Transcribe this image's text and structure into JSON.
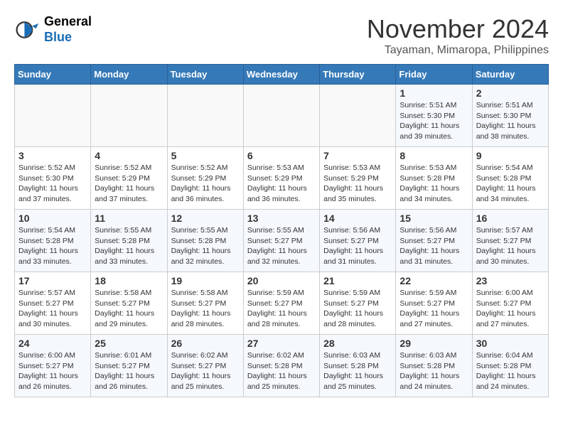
{
  "header": {
    "logo_line1": "General",
    "logo_line2": "Blue",
    "month": "November 2024",
    "location": "Tayaman, Mimaropa, Philippines"
  },
  "days_of_week": [
    "Sunday",
    "Monday",
    "Tuesday",
    "Wednesday",
    "Thursday",
    "Friday",
    "Saturday"
  ],
  "weeks": [
    [
      {
        "day": "",
        "info": ""
      },
      {
        "day": "",
        "info": ""
      },
      {
        "day": "",
        "info": ""
      },
      {
        "day": "",
        "info": ""
      },
      {
        "day": "",
        "info": ""
      },
      {
        "day": "1",
        "info": "Sunrise: 5:51 AM\nSunset: 5:30 PM\nDaylight: 11 hours\nand 39 minutes."
      },
      {
        "day": "2",
        "info": "Sunrise: 5:51 AM\nSunset: 5:30 PM\nDaylight: 11 hours\nand 38 minutes."
      }
    ],
    [
      {
        "day": "3",
        "info": "Sunrise: 5:52 AM\nSunset: 5:30 PM\nDaylight: 11 hours\nand 37 minutes."
      },
      {
        "day": "4",
        "info": "Sunrise: 5:52 AM\nSunset: 5:29 PM\nDaylight: 11 hours\nand 37 minutes."
      },
      {
        "day": "5",
        "info": "Sunrise: 5:52 AM\nSunset: 5:29 PM\nDaylight: 11 hours\nand 36 minutes."
      },
      {
        "day": "6",
        "info": "Sunrise: 5:53 AM\nSunset: 5:29 PM\nDaylight: 11 hours\nand 36 minutes."
      },
      {
        "day": "7",
        "info": "Sunrise: 5:53 AM\nSunset: 5:29 PM\nDaylight: 11 hours\nand 35 minutes."
      },
      {
        "day": "8",
        "info": "Sunrise: 5:53 AM\nSunset: 5:28 PM\nDaylight: 11 hours\nand 34 minutes."
      },
      {
        "day": "9",
        "info": "Sunrise: 5:54 AM\nSunset: 5:28 PM\nDaylight: 11 hours\nand 34 minutes."
      }
    ],
    [
      {
        "day": "10",
        "info": "Sunrise: 5:54 AM\nSunset: 5:28 PM\nDaylight: 11 hours\nand 33 minutes."
      },
      {
        "day": "11",
        "info": "Sunrise: 5:55 AM\nSunset: 5:28 PM\nDaylight: 11 hours\nand 33 minutes."
      },
      {
        "day": "12",
        "info": "Sunrise: 5:55 AM\nSunset: 5:28 PM\nDaylight: 11 hours\nand 32 minutes."
      },
      {
        "day": "13",
        "info": "Sunrise: 5:55 AM\nSunset: 5:27 PM\nDaylight: 11 hours\nand 32 minutes."
      },
      {
        "day": "14",
        "info": "Sunrise: 5:56 AM\nSunset: 5:27 PM\nDaylight: 11 hours\nand 31 minutes."
      },
      {
        "day": "15",
        "info": "Sunrise: 5:56 AM\nSunset: 5:27 PM\nDaylight: 11 hours\nand 31 minutes."
      },
      {
        "day": "16",
        "info": "Sunrise: 5:57 AM\nSunset: 5:27 PM\nDaylight: 11 hours\nand 30 minutes."
      }
    ],
    [
      {
        "day": "17",
        "info": "Sunrise: 5:57 AM\nSunset: 5:27 PM\nDaylight: 11 hours\nand 30 minutes."
      },
      {
        "day": "18",
        "info": "Sunrise: 5:58 AM\nSunset: 5:27 PM\nDaylight: 11 hours\nand 29 minutes."
      },
      {
        "day": "19",
        "info": "Sunrise: 5:58 AM\nSunset: 5:27 PM\nDaylight: 11 hours\nand 28 minutes."
      },
      {
        "day": "20",
        "info": "Sunrise: 5:59 AM\nSunset: 5:27 PM\nDaylight: 11 hours\nand 28 minutes."
      },
      {
        "day": "21",
        "info": "Sunrise: 5:59 AM\nSunset: 5:27 PM\nDaylight: 11 hours\nand 28 minutes."
      },
      {
        "day": "22",
        "info": "Sunrise: 5:59 AM\nSunset: 5:27 PM\nDaylight: 11 hours\nand 27 minutes."
      },
      {
        "day": "23",
        "info": "Sunrise: 6:00 AM\nSunset: 5:27 PM\nDaylight: 11 hours\nand 27 minutes."
      }
    ],
    [
      {
        "day": "24",
        "info": "Sunrise: 6:00 AM\nSunset: 5:27 PM\nDaylight: 11 hours\nand 26 minutes."
      },
      {
        "day": "25",
        "info": "Sunrise: 6:01 AM\nSunset: 5:27 PM\nDaylight: 11 hours\nand 26 minutes."
      },
      {
        "day": "26",
        "info": "Sunrise: 6:02 AM\nSunset: 5:27 PM\nDaylight: 11 hours\nand 25 minutes."
      },
      {
        "day": "27",
        "info": "Sunrise: 6:02 AM\nSunset: 5:28 PM\nDaylight: 11 hours\nand 25 minutes."
      },
      {
        "day": "28",
        "info": "Sunrise: 6:03 AM\nSunset: 5:28 PM\nDaylight: 11 hours\nand 25 minutes."
      },
      {
        "day": "29",
        "info": "Sunrise: 6:03 AM\nSunset: 5:28 PM\nDaylight: 11 hours\nand 24 minutes."
      },
      {
        "day": "30",
        "info": "Sunrise: 6:04 AM\nSunset: 5:28 PM\nDaylight: 11 hours\nand 24 minutes."
      }
    ]
  ]
}
